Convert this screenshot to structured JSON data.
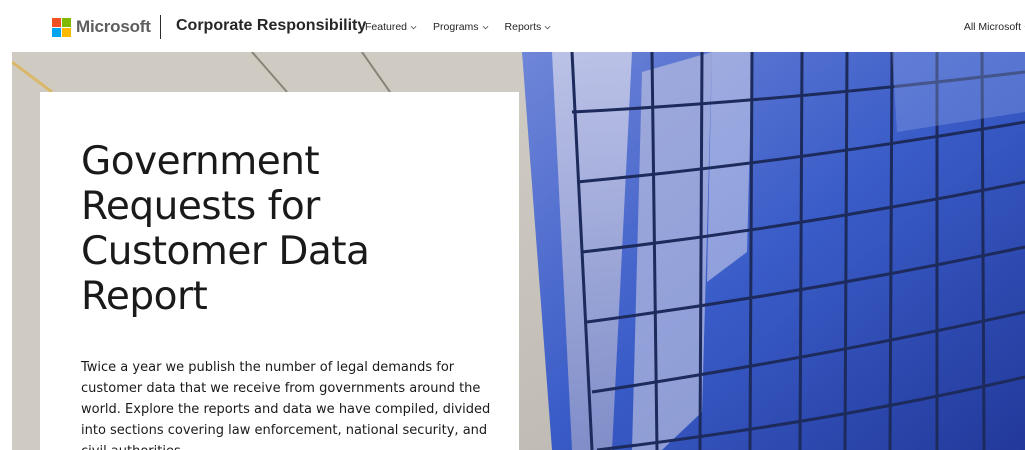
{
  "header": {
    "logo_text": "Microsoft",
    "brand": "Corporate Responsibility",
    "nav": [
      {
        "label": "Featured"
      },
      {
        "label": "Programs"
      },
      {
        "label": "Reports"
      }
    ],
    "all_microsoft": "All Microsoft"
  },
  "hero": {
    "title": "Government Requests for Customer Data Report",
    "description": "Twice a year we publish the number of legal demands for customer data that we receive from governments around the world. Explore the reports and data we have compiled, divided into sections covering law enforcement, national security, and civil authorities."
  },
  "colors": {
    "logo_red": "#f25022",
    "logo_green": "#7fba00",
    "logo_blue": "#00a4ef",
    "logo_yellow": "#ffb900",
    "glass_blue": "#3a5cc8"
  }
}
